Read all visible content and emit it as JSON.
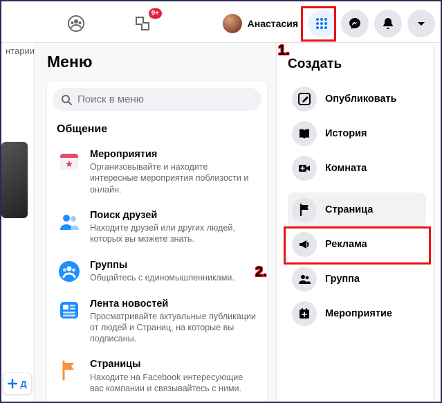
{
  "topbar": {
    "badge": "9+",
    "user_name": "Анастасия"
  },
  "left_strip": {
    "partial_text": "нтарии",
    "add_label": "Д"
  },
  "menu": {
    "title": "Меню",
    "search_placeholder": "Поиск в меню",
    "section_label": "Общение",
    "items": [
      {
        "title": "Мероприятия",
        "desc": "Организовывайте и находите интересные мероприятия поблизости и онлайн."
      },
      {
        "title": "Поиск друзей",
        "desc": "Находите друзей или других людей, которых вы можете знать."
      },
      {
        "title": "Группы",
        "desc": "Общайтесь с единомышленниками."
      },
      {
        "title": "Лента новостей",
        "desc": "Просматривайте актуальные публикации от людей и Страниц, на которые вы подписаны."
      },
      {
        "title": "Страницы",
        "desc": "Находите на Facebook интересующие вас компании и связывайтесь с ними."
      }
    ]
  },
  "create": {
    "title": "Создать",
    "items": [
      {
        "label": "Опубликовать"
      },
      {
        "label": "История"
      },
      {
        "label": "Комната"
      },
      {
        "label": "Страница"
      },
      {
        "label": "Реклама"
      },
      {
        "label": "Группа"
      },
      {
        "label": "Мероприятие"
      }
    ]
  },
  "annotations": {
    "one": "1.",
    "two": "2."
  }
}
